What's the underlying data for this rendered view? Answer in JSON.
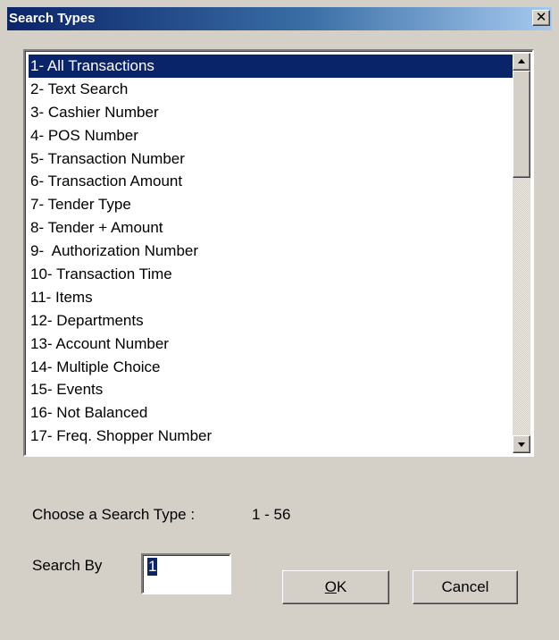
{
  "window": {
    "title": "Search Types",
    "close_glyph": "✕"
  },
  "list": {
    "items": [
      "1- All Transactions",
      "2- Text Search",
      "3- Cashier Number",
      "4- POS Number",
      "5- Transaction Number",
      "6- Transaction Amount",
      "7- Tender Type",
      "8- Tender + Amount",
      "9-  Authorization Number",
      "10- Transaction Time",
      "11- Items",
      "12- Departments",
      "13- Account Number",
      "14- Multiple Choice",
      "15- Events",
      "16- Not Balanced",
      "17- Freq. Shopper Number"
    ],
    "selected_index": 0
  },
  "form": {
    "choose_label": "Choose a Search Type :",
    "range_label": "1 - 56",
    "search_by_label": "Search By",
    "search_by_value": "1"
  },
  "buttons": {
    "ok_accel": "O",
    "ok_rest": "K",
    "cancel_label": "Cancel"
  },
  "colors": {
    "selection": "#0a246a",
    "face": "#d4d0c8"
  }
}
